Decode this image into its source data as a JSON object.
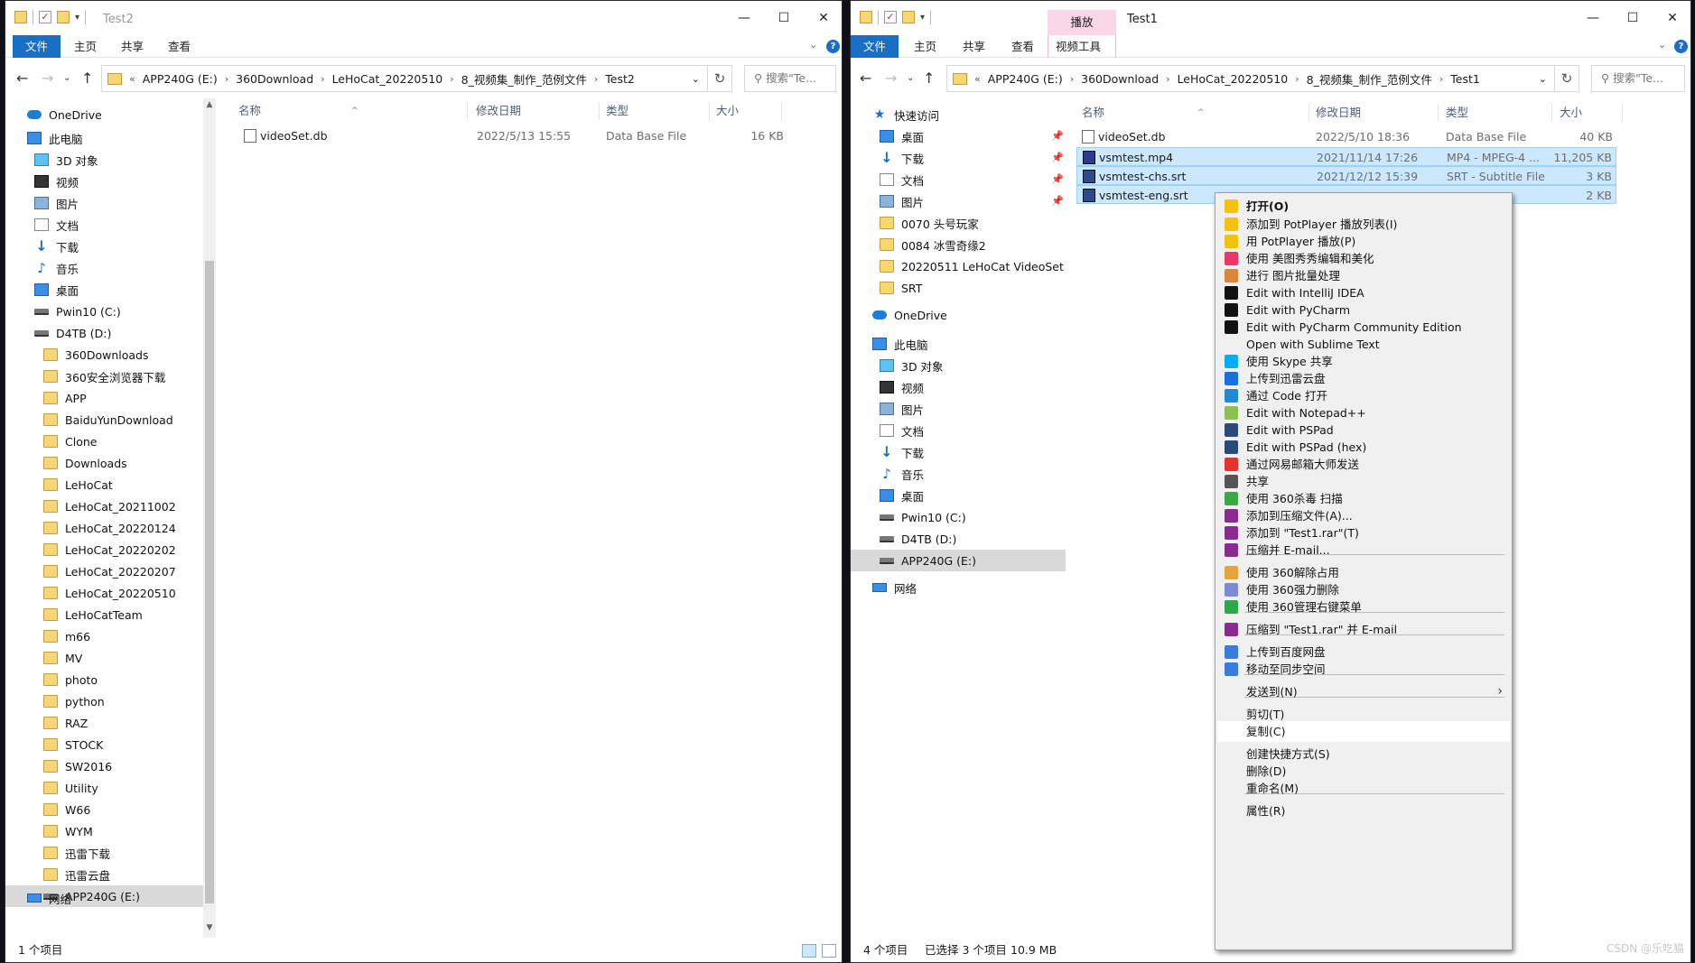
{
  "left_window": {
    "title": "Test2",
    "ribbon_tabs": [
      "文件",
      "主页",
      "共享",
      "查看"
    ],
    "breadcrumb": [
      "APP240G (E:)",
      "360Download",
      "LeHoCat_20220510",
      "8_视频集_制作_范例文件",
      "Test2"
    ],
    "search_placeholder": "搜索\"Te...",
    "nav_items": [
      {
        "label": "OneDrive",
        "icon": "cloud-icon"
      },
      {
        "label": "此电脑",
        "icon": "computer-icon"
      },
      {
        "label": "3D 对象",
        "icon": "cube-icon"
      },
      {
        "label": "视频",
        "icon": "video-icon"
      },
      {
        "label": "图片",
        "icon": "picture-icon"
      },
      {
        "label": "文档",
        "icon": "document-icon"
      },
      {
        "label": "下载",
        "icon": "download-icon"
      },
      {
        "label": "音乐",
        "icon": "music-icon"
      },
      {
        "label": "桌面",
        "icon": "desktop-icon"
      },
      {
        "label": "Pwin10 (C:)",
        "icon": "drive-icon"
      },
      {
        "label": "D4TB (D:)",
        "icon": "drive-icon"
      },
      {
        "label": "360Downloads",
        "icon": "folder-icon"
      },
      {
        "label": "360安全浏览器下载",
        "icon": "folder-icon"
      },
      {
        "label": "APP",
        "icon": "folder-icon"
      },
      {
        "label": "BaiduYunDownload",
        "icon": "folder-icon"
      },
      {
        "label": "Clone",
        "icon": "folder-icon"
      },
      {
        "label": "Downloads",
        "icon": "folder-icon"
      },
      {
        "label": "LeHoCat",
        "icon": "folder-icon"
      },
      {
        "label": "LeHoCat_20211002",
        "icon": "folder-icon"
      },
      {
        "label": "LeHoCat_20220124",
        "icon": "folder-icon"
      },
      {
        "label": "LeHoCat_20220202",
        "icon": "folder-icon"
      },
      {
        "label": "LeHoCat_20220207",
        "icon": "folder-icon"
      },
      {
        "label": "LeHoCat_20220510",
        "icon": "folder-icon"
      },
      {
        "label": "LeHoCatTeam",
        "icon": "folder-icon"
      },
      {
        "label": "m66",
        "icon": "folder-icon"
      },
      {
        "label": "MV",
        "icon": "folder-icon"
      },
      {
        "label": "photo",
        "icon": "folder-icon"
      },
      {
        "label": "python",
        "icon": "folder-icon"
      },
      {
        "label": "RAZ",
        "icon": "folder-icon"
      },
      {
        "label": "STOCK",
        "icon": "folder-icon"
      },
      {
        "label": "SW2016",
        "icon": "folder-icon"
      },
      {
        "label": "Utility",
        "icon": "folder-icon"
      },
      {
        "label": "W66",
        "icon": "folder-icon"
      },
      {
        "label": "WYM",
        "icon": "folder-icon"
      },
      {
        "label": "迅雷下载",
        "icon": "folder-icon"
      },
      {
        "label": "迅雷云盘",
        "icon": "folder-icon"
      },
      {
        "label": "APP240G (E:)",
        "icon": "drive-icon"
      },
      {
        "label": "网络",
        "icon": "network-icon"
      }
    ],
    "columns": [
      "名称",
      "修改日期",
      "类型",
      "大小"
    ],
    "files": [
      {
        "name": "videoSet.db",
        "date": "2022/5/13 15:55",
        "type": "Data Base File",
        "size": "16 KB"
      }
    ],
    "status": "1 个项目"
  },
  "right_window": {
    "title": "Test1",
    "ribbon_tabs": [
      "文件",
      "主页",
      "共享",
      "查看"
    ],
    "context_tab_group": "播放",
    "context_tab": "视频工具",
    "breadcrumb": [
      "APP240G (E:)",
      "360Download",
      "LeHoCat_20220510",
      "8_视频集_制作_范例文件",
      "Test1"
    ],
    "search_placeholder": "搜索\"Te...",
    "nav_items": [
      {
        "label": "快速访问",
        "icon": "star-icon"
      },
      {
        "label": "桌面",
        "icon": "desktop-icon"
      },
      {
        "label": "下载",
        "icon": "download-icon"
      },
      {
        "label": "文档",
        "icon": "document-icon"
      },
      {
        "label": "图片",
        "icon": "picture-icon"
      },
      {
        "label": "0070 头号玩家",
        "icon": "folder-icon"
      },
      {
        "label": "0084 冰雪奇缘2",
        "icon": "folder-icon"
      },
      {
        "label": "20220511 LeHoCat VideoSet",
        "icon": "folder-icon"
      },
      {
        "label": "SRT",
        "icon": "folder-icon"
      },
      {
        "label": "OneDrive",
        "icon": "cloud-icon"
      },
      {
        "label": "此电脑",
        "icon": "computer-icon"
      },
      {
        "label": "3D 对象",
        "icon": "cube-icon"
      },
      {
        "label": "视频",
        "icon": "video-icon"
      },
      {
        "label": "图片",
        "icon": "picture-icon"
      },
      {
        "label": "文档",
        "icon": "document-icon"
      },
      {
        "label": "下载",
        "icon": "download-icon"
      },
      {
        "label": "音乐",
        "icon": "music-icon"
      },
      {
        "label": "桌面",
        "icon": "desktop-icon"
      },
      {
        "label": "Pwin10 (C:)",
        "icon": "drive-icon"
      },
      {
        "label": "D4TB (D:)",
        "icon": "drive-icon"
      },
      {
        "label": "APP240G (E:)",
        "icon": "drive-icon"
      },
      {
        "label": "网络",
        "icon": "network-icon"
      }
    ],
    "columns": [
      "名称",
      "修改日期",
      "类型",
      "大小"
    ],
    "files": [
      {
        "name": "videoSet.db",
        "date": "2022/5/10 18:36",
        "type": "Data Base File",
        "size": "40 KB"
      },
      {
        "name": "vsmtest.mp4",
        "date": "2021/11/14 17:26",
        "type": "MP4 - MPEG-4 ...",
        "size": "11,205 KB"
      },
      {
        "name": "vsmtest-chs.srt",
        "date": "2021/12/12 15:39",
        "type": "SRT - Subtitle File",
        "size": "3 KB"
      },
      {
        "name": "vsmtest-eng.srt",
        "date": "",
        "type": "",
        "size": "2 KB"
      }
    ],
    "status_count": "4 个项目",
    "status_selected": "已选择 3 个项目",
    "status_size": "10.9 MB"
  },
  "context_menu": {
    "items": [
      {
        "label": "打开(O)",
        "icon": "play-icon",
        "color": "#f4c20d",
        "bold": true
      },
      {
        "label": "添加到 PotPlayer 播放列表(I)",
        "icon": "potplayer-icon",
        "color": "#f4c20d"
      },
      {
        "label": "用 PotPlayer 播放(P)",
        "icon": "potplayer-icon",
        "color": "#f4c20d"
      },
      {
        "label": "使用 美图秀秀编辑和美化",
        "icon": "meitu-icon",
        "color": "#e8386a"
      },
      {
        "label": "进行 图片批量处理",
        "icon": "batch-image-icon",
        "color": "#d9863a"
      },
      {
        "label": "Edit with IntelliJ IDEA",
        "icon": "intellij-icon",
        "color": "#111111"
      },
      {
        "label": "Edit with PyCharm",
        "icon": "pycharm-icon",
        "color": "#111111"
      },
      {
        "label": "Edit with PyCharm Community Edition",
        "icon": "pycharm-icon",
        "color": "#111111"
      },
      {
        "label": "Open with Sublime Text",
        "icon": "",
        "color": ""
      },
      {
        "label": "使用 Skype 共享",
        "icon": "skype-icon",
        "color": "#00aff0"
      },
      {
        "label": "上传到迅雷云盘",
        "icon": "xunlei-icon",
        "color": "#1a6fe0"
      },
      {
        "label": "通过 Code 打开",
        "icon": "vscode-icon",
        "color": "#1f8ad2"
      },
      {
        "label": "Edit with Notepad++",
        "icon": "notepadpp-icon",
        "color": "#8cc152"
      },
      {
        "label": "Edit with PSPad",
        "icon": "pspad-icon",
        "color": "#2a4a7a"
      },
      {
        "label": "Edit with PSPad (hex)",
        "icon": "pspad-icon",
        "color": "#2a4a7a"
      },
      {
        "label": "通过网易邮箱大师发送",
        "icon": "mail-master-icon",
        "color": "#e5322d"
      },
      {
        "label": "共享",
        "icon": "share-icon",
        "color": "#555555"
      },
      {
        "label": "使用 360杀毒 扫描",
        "icon": "360-antivirus-icon",
        "color": "#3aa845"
      },
      {
        "label": "添加到压缩文件(A)...",
        "icon": "winrar-icon",
        "color": "#8a2b8f"
      },
      {
        "label": "添加到 \"Test1.rar\"(T)",
        "icon": "winrar-icon",
        "color": "#8a2b8f"
      },
      {
        "label": "压缩并 E-mail...",
        "icon": "winrar-icon",
        "color": "#8a2b8f"
      },
      {
        "label": "使用 360解除占用",
        "icon": "360-unlock-icon",
        "color": "#e6a23c"
      },
      {
        "label": "使用 360强力删除",
        "icon": "360-delete-icon",
        "color": "#7b8bd6"
      },
      {
        "label": "使用 360管理右键菜单",
        "icon": "360-menu-icon",
        "color": "#2aa84a"
      },
      {
        "label": "压缩到 \"Test1.rar\" 并 E-mail",
        "icon": "winrar-icon",
        "color": "#8a2b8f"
      },
      {
        "label": "上传到百度网盘",
        "icon": "baidu-pan-icon",
        "color": "#3a7be0"
      },
      {
        "label": "移动至同步空间",
        "icon": "baidu-sync-icon",
        "color": "#3a7be0"
      },
      {
        "label": "发送到(N)",
        "icon": "",
        "color": "",
        "submenu": true
      },
      {
        "label": "剪切(T)",
        "icon": "",
        "color": ""
      },
      {
        "label": "复制(C)",
        "icon": "",
        "color": "",
        "highlighted": true
      },
      {
        "label": "创建快捷方式(S)",
        "icon": "",
        "color": ""
      },
      {
        "label": "删除(D)",
        "icon": "",
        "color": ""
      },
      {
        "label": "重命名(M)",
        "icon": "",
        "color": ""
      },
      {
        "label": "属性(R)",
        "icon": "",
        "color": ""
      }
    ]
  },
  "watermark": "CSDN @乐吃猫"
}
